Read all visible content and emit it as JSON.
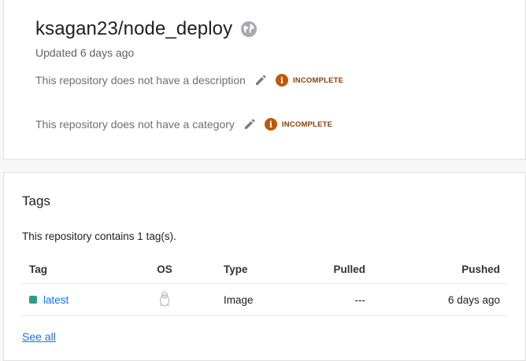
{
  "repo": {
    "title": "ksagan23/node_deploy",
    "updated": "Updated 6 days ago",
    "description_text": "This repository does not have a description",
    "category_text": "This repository does not have a category",
    "badge_label": "INCOMPLETE",
    "badge_glyph": "i",
    "colors": {
      "badge": "#c0570b",
      "badge_text": "#8a3f08"
    }
  },
  "tags": {
    "heading": "Tags",
    "count_text": "This repository contains 1 tag(s).",
    "columns": [
      "Tag",
      "OS",
      "Type",
      "Pulled",
      "Pushed"
    ],
    "rows": [
      {
        "tag": "latest",
        "os_icon": "linux-tux-icon",
        "type": "Image",
        "pulled": "---",
        "pushed": "6 days ago"
      }
    ],
    "see_all": "See all",
    "colors": {
      "tag_dot": "#2f9c8a",
      "link": "#1a73e8"
    }
  }
}
